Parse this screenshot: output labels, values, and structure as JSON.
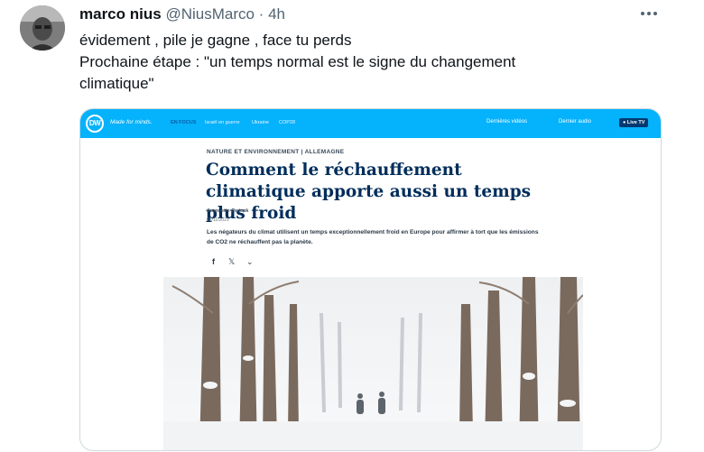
{
  "tweet": {
    "display_name": "marco nius",
    "handle": "@NiusMarco",
    "separator": "·",
    "time": "4h",
    "text_lines": [
      "évidement , pile je gagne , face tu perds",
      "Prochaine étape : \"un temps normal est le signe du changement",
      "climatique\""
    ],
    "more_icon": "more-dots-icon"
  },
  "card": {
    "site": {
      "logo": "DW",
      "tagline": "Made for minds.",
      "nav": [
        "EN FOCUS",
        "Israël en guerre",
        "Ukraine",
        "COP28"
      ],
      "videos": "Dernières vidéos",
      "audio": "Dernier audio",
      "live": "● Live TV"
    },
    "article": {
      "kicker": "NATURE ET ENVIRONNEMENT | ALLEMAGNE",
      "headline": "Comment le réchauffement climatique apporte aussi un temps plus froid",
      "author": "Jeannette Cwienk",
      "date": "02/11/2021",
      "teaser": "Les négateurs du climat utilisent un temps exceptionnellement froid en Europe pour affirmer à tort que les émissions de CO2 ne réchauffent pas la planète.",
      "share": [
        "f",
        "𝕏",
        "⌄"
      ]
    },
    "photo_icon": "snowy-avenue-photo"
  }
}
